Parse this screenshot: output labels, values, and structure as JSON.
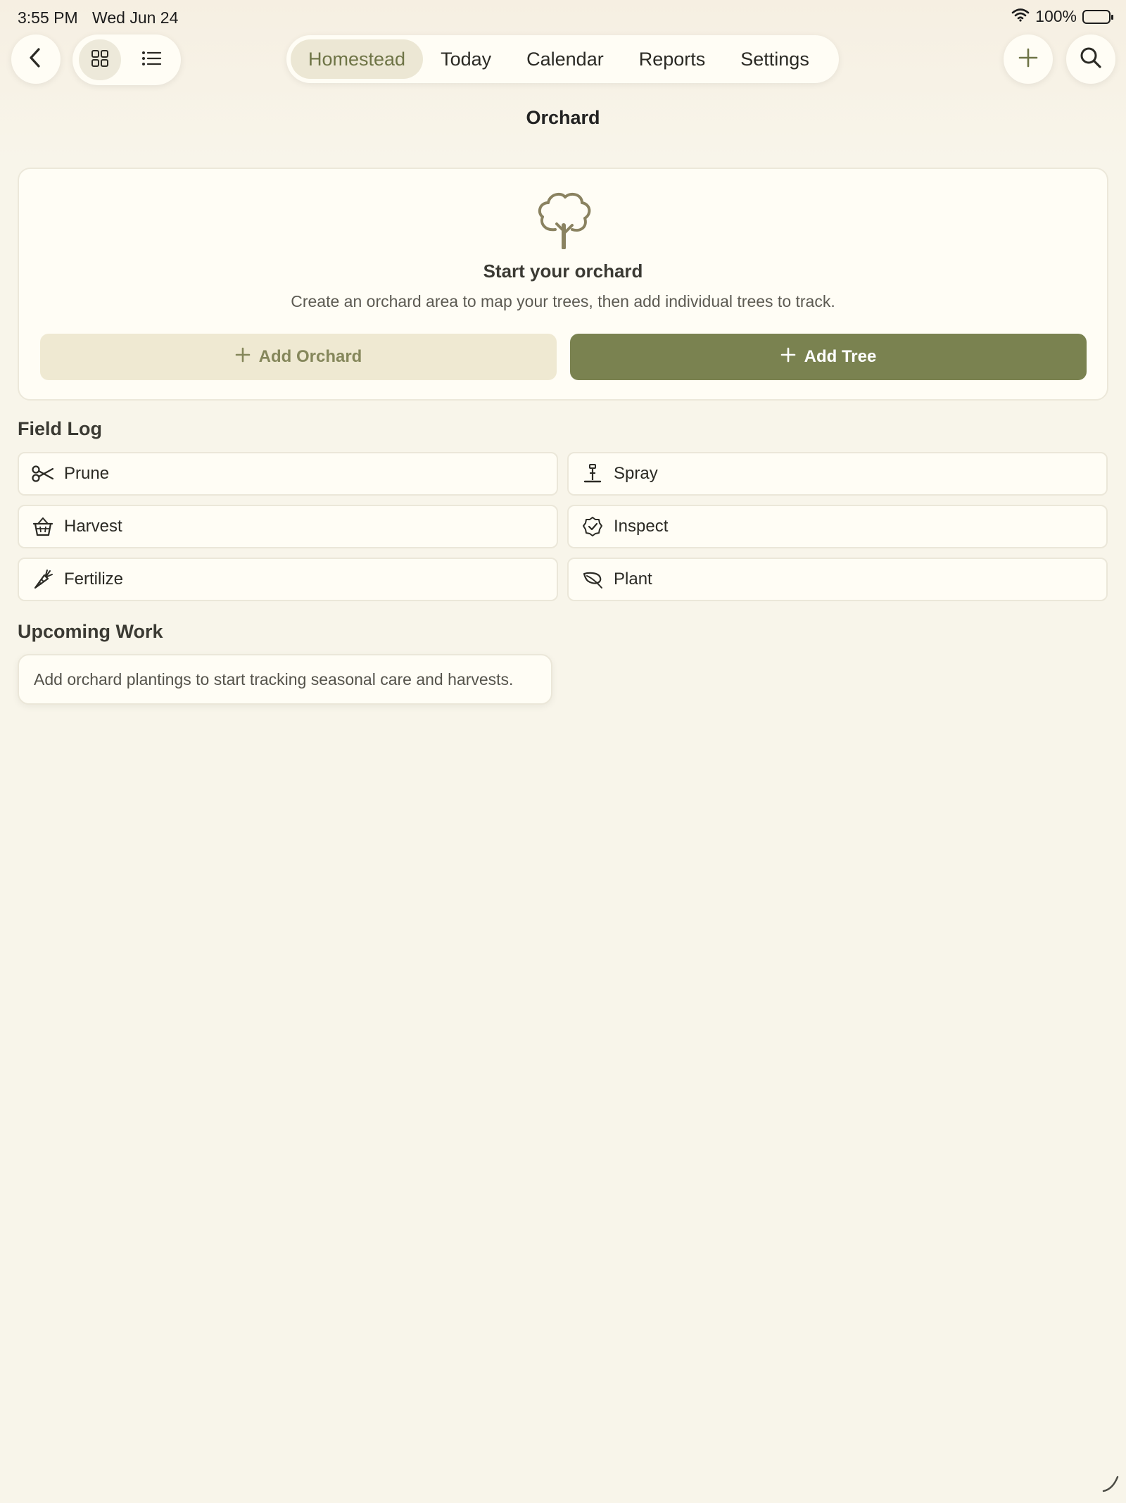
{
  "status_bar": {
    "time": "3:55 PM",
    "date": "Wed Jun 24",
    "battery": "100%"
  },
  "toolbar": {
    "back_icon": "chevron-left-icon",
    "view_toggle": [
      "grid-icon",
      "list-icon"
    ],
    "active_view": "grid",
    "add_icon": "plus-icon",
    "search_icon": "magnifying-glass-icon"
  },
  "tabs": [
    {
      "label": "Homestead",
      "active": true
    },
    {
      "label": "Today",
      "active": false
    },
    {
      "label": "Calendar",
      "active": false
    },
    {
      "label": "Reports",
      "active": false
    },
    {
      "label": "Settings",
      "active": false
    }
  ],
  "page": {
    "title": "Orchard"
  },
  "hero": {
    "icon": "tree-icon",
    "title": "Start your orchard",
    "description": "Create an orchard area to map your trees, then add individual trees to track.",
    "secondary_button": "Add Orchard",
    "primary_button": "Add Tree"
  },
  "field_log": {
    "title": "Field Log",
    "actions": [
      {
        "label": "Prune",
        "icon": "scissors-icon"
      },
      {
        "label": "Spray",
        "icon": "sprayer-icon"
      },
      {
        "label": "Harvest",
        "icon": "basket-icon"
      },
      {
        "label": "Inspect",
        "icon": "check-badge-icon"
      },
      {
        "label": "Fertilize",
        "icon": "carrot-icon"
      },
      {
        "label": "Plant",
        "icon": "leaf-icon"
      }
    ]
  },
  "upcoming": {
    "title": "Upcoming Work",
    "empty_message": "Add orchard plantings to start tracking seasonal care and harvests."
  },
  "colors": {
    "background": "#f8f5ea",
    "card": "#fffdf5",
    "accent": "#7a8250",
    "accent_soft": "#efe9d2",
    "active_tab_text": "#6e7446"
  }
}
